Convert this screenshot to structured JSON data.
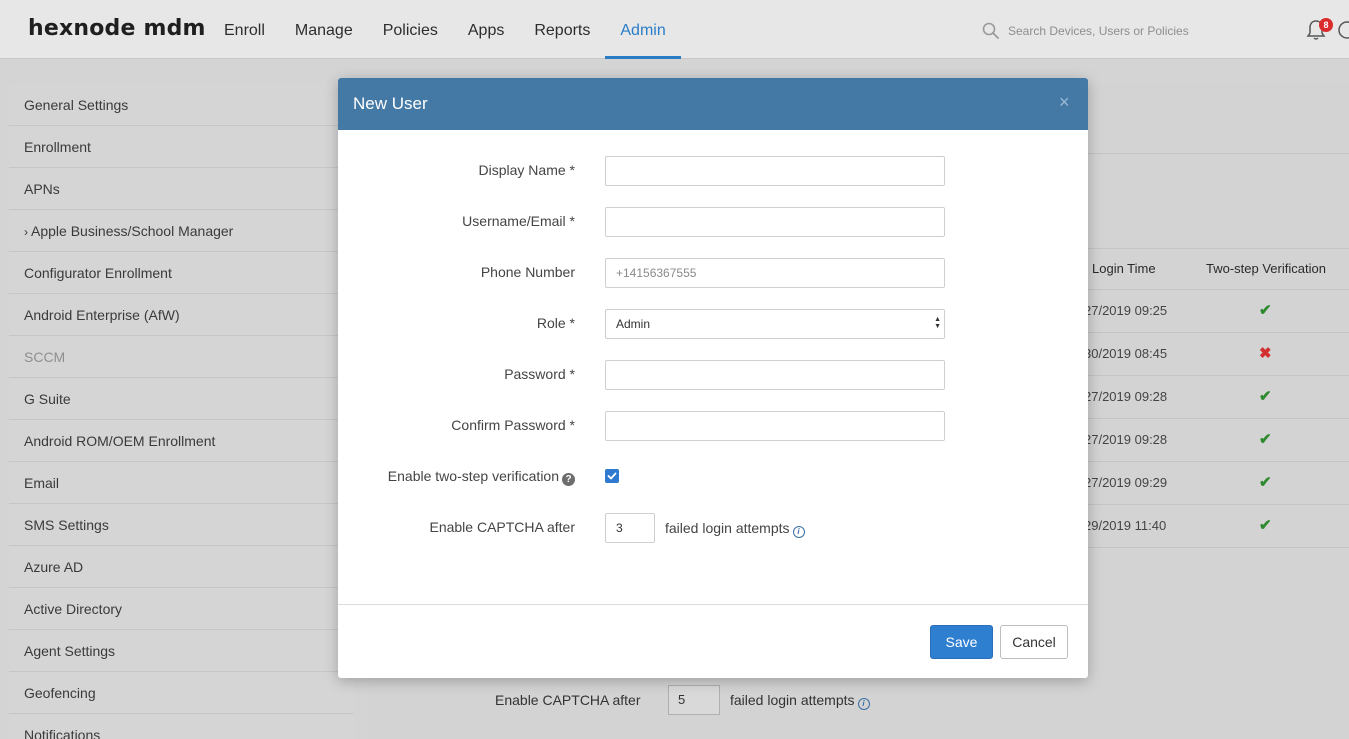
{
  "brand": {
    "logo": "hexnode mdm"
  },
  "nav": {
    "items": [
      {
        "label": "Enroll"
      },
      {
        "label": "Manage"
      },
      {
        "label": "Policies"
      },
      {
        "label": "Apps"
      },
      {
        "label": "Reports"
      },
      {
        "label": "Admin"
      }
    ],
    "active": "Admin"
  },
  "search": {
    "placeholder": "Search Devices, Users or Policies"
  },
  "notifications": {
    "count": "8"
  },
  "sidebar": {
    "items": [
      {
        "label": "General Settings"
      },
      {
        "label": "Enrollment"
      },
      {
        "label": "APNs"
      },
      {
        "label": "Apple Business/School Manager"
      },
      {
        "label": "Configurator Enrollment"
      },
      {
        "label": "Android Enterprise (AfW)"
      },
      {
        "label": "SCCM"
      },
      {
        "label": "G Suite"
      },
      {
        "label": "Android ROM/OEM Enrollment"
      },
      {
        "label": "Email"
      },
      {
        "label": "SMS Settings"
      },
      {
        "label": "Azure AD"
      },
      {
        "label": "Active Directory"
      },
      {
        "label": "Agent Settings"
      },
      {
        "label": "Geofencing"
      },
      {
        "label": "Notifications"
      }
    ],
    "expand_caret": "›"
  },
  "background_table": {
    "headers": {
      "login_time": "Login Time",
      "two_step": "Two-step Verification"
    },
    "rows": [
      {
        "login_time": "27/2019 09:25",
        "two_step": "✔"
      },
      {
        "login_time": "30/2019 08:45",
        "two_step": "✖"
      },
      {
        "login_time": "27/2019 09:28",
        "two_step": "✔"
      },
      {
        "login_time": "27/2019 09:28",
        "two_step": "✔"
      },
      {
        "login_time": "27/2019 09:29",
        "two_step": "✔"
      },
      {
        "login_time": "29/2019 11:40",
        "two_step": "✔"
      }
    ]
  },
  "background_captcha": {
    "label": "Enable CAPTCHA after",
    "value": "5",
    "suffix": "failed login attempts"
  },
  "modal": {
    "title": "New User",
    "close": "×",
    "fields": {
      "display_name": {
        "label": "Display Name *",
        "value": ""
      },
      "username": {
        "label": "Username/Email *",
        "value": ""
      },
      "phone": {
        "label": "Phone Number",
        "placeholder": "+14156367555"
      },
      "role": {
        "label": "Role *",
        "value": "Admin"
      },
      "password": {
        "label": "Password *",
        "value": ""
      },
      "confirm_password": {
        "label": "Confirm Password *",
        "value": ""
      },
      "two_step": {
        "label": "Enable two-step verification",
        "checked": true
      },
      "captcha": {
        "label": "Enable CAPTCHA after",
        "value": "3",
        "suffix": "failed login attempts"
      }
    },
    "help_glyph": "?",
    "info_glyph": "i",
    "save_label": "Save",
    "cancel_label": "Cancel"
  },
  "colors": {
    "accent": "#2a7cc7",
    "modal_header": "#4478a5",
    "save_button": "#2f7fd0",
    "success": "#2e8a2e",
    "error": "#d23030",
    "badge": "#d92b2b"
  }
}
